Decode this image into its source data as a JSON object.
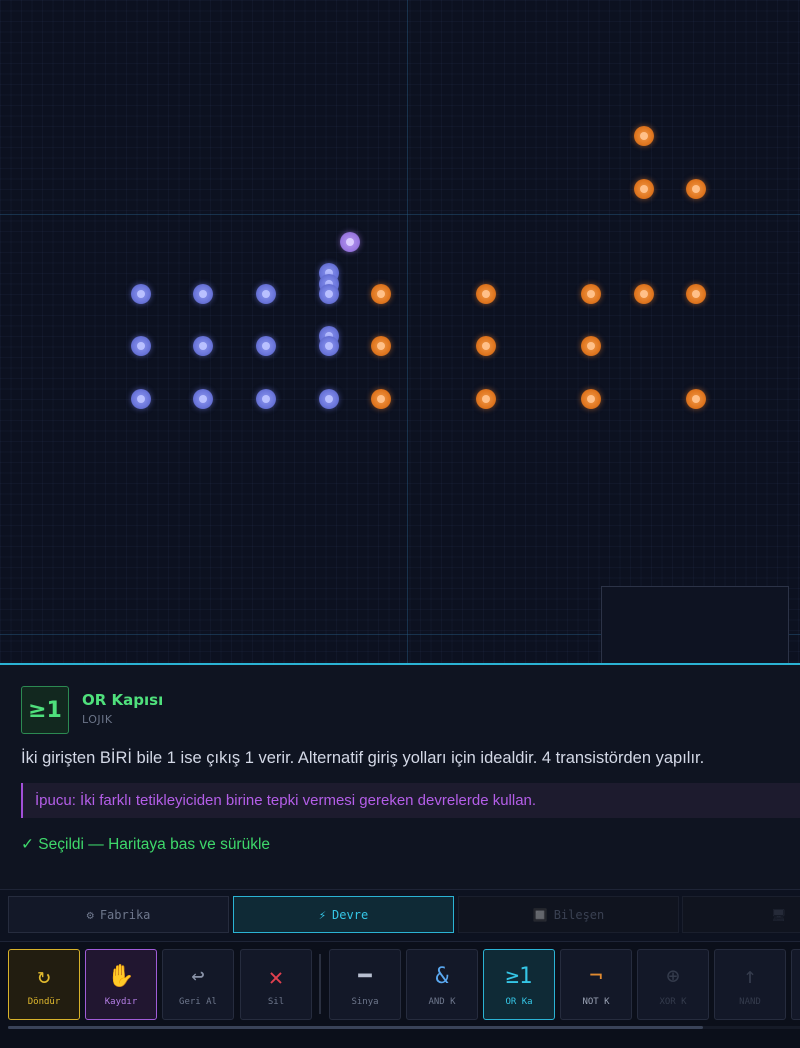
{
  "gate": {
    "icon_text": "≥1",
    "name": "OR Kapısı",
    "category": "LOJIK",
    "description": "İki girişten BİRİ bile 1 ise çıkış 1 verir. Alternatif giriş yolları için idealdir. 4 transistörden yapılır.",
    "tip": "İpucu: İki farklı tetikleyiciden birine tepki vermesi gereken devrelerde kullan.",
    "selected": "✓ Seçildi — Haritaya bas ve sürükle"
  },
  "tabs": [
    {
      "icon": "⚙",
      "label": "Fabrika",
      "icon_name": "gear-icon"
    },
    {
      "icon": "⚡",
      "label": "Devre",
      "icon_name": "lightning-icon"
    },
    {
      "icon": "🔲",
      "label": "Bileşen",
      "icon_name": "component-icon"
    },
    {
      "icon": "🖥",
      "label": "",
      "icon_name": "monitor-icon"
    }
  ],
  "tools": [
    {
      "symbol": "↻",
      "label": "Döndür",
      "icon_name": "rotate-icon"
    },
    {
      "symbol": "✋",
      "label": "Kaydır",
      "icon_name": "hand-icon"
    },
    {
      "symbol": "↩",
      "label": "Geri Al",
      "icon_name": "undo-icon"
    },
    {
      "symbol": "✕",
      "label": "Sil",
      "icon_name": "delete-icon"
    },
    {
      "symbol": "━",
      "label": "Sinya",
      "icon_name": "wire-icon"
    },
    {
      "symbol": "&",
      "label": "AND K",
      "icon_name": "and-gate-icon"
    },
    {
      "symbol": "≥1",
      "label": "OR Ka",
      "icon_name": "or-gate-icon"
    },
    {
      "symbol": "¬",
      "label": "NOT K",
      "icon_name": "not-gate-icon"
    },
    {
      "symbol": "⊕",
      "label": "XOR K",
      "icon_name": "xor-gate-icon"
    },
    {
      "symbol": "↑",
      "label": "NAND",
      "icon_name": "nand-gate-icon"
    }
  ],
  "colors": {
    "accent_cyan": "#2bb3d4",
    "gate_green": "#4fe07c",
    "tip_purple": "#b45ee8",
    "selected_green": "#3ed86b",
    "node_blue": "#6d78dc",
    "node_orange": "#e0761f",
    "node_purple": "#9a78e0"
  }
}
